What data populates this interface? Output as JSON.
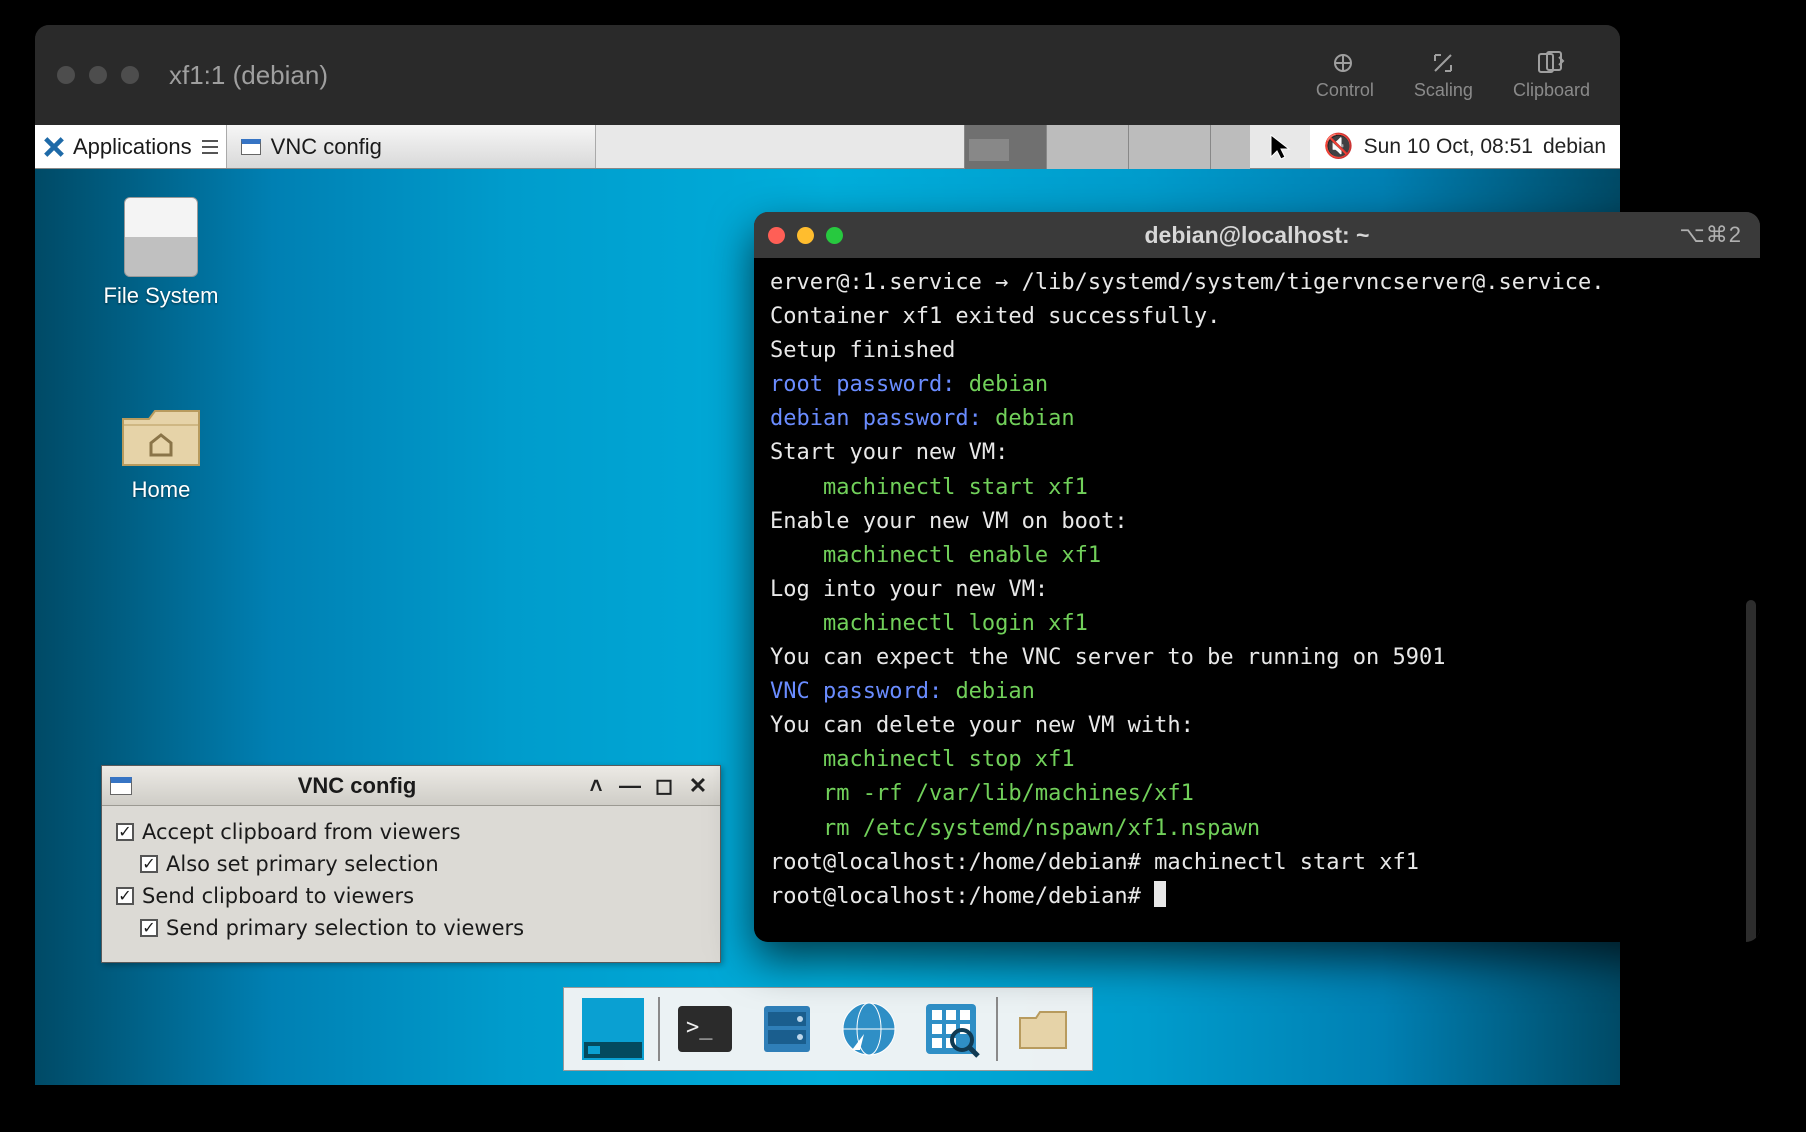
{
  "mac": {
    "title": "xf1:1 (debian)",
    "toolbar": {
      "control": "Control",
      "scaling": "Scaling",
      "clipboard": "Clipboard"
    }
  },
  "debian": {
    "applications_label": "Applications",
    "taskbar_item": "VNC config",
    "datetime": "Sun 10 Oct, 08:51",
    "user": "debian",
    "desktop": {
      "filesystem": "File System",
      "home": "Home"
    }
  },
  "vnc_config": {
    "title": "VNC config",
    "options": [
      "Accept clipboard from viewers",
      "Also set primary selection",
      "Send clipboard to viewers",
      "Send primary selection to viewers"
    ]
  },
  "dock": {
    "items": [
      "show-desktop",
      "terminal",
      "file-manager",
      "web-browser",
      "app-finder",
      "folder"
    ]
  },
  "terminal": {
    "title": "debian@localhost: ~",
    "shortcut": "⌥⌘2",
    "lines": {
      "l1": "erver@:1.service → /lib/systemd/system/tigervncserver@.service.",
      "l2": "Container xf1 exited successfully.",
      "l3": "Setup finished",
      "root_pw_label": "root password: ",
      "root_pw_val": "debian",
      "debian_pw_label": "debian password: ",
      "debian_pw_val": "debian",
      "start_hdr": "Start your new VM:",
      "start_cmd": "    machinectl start xf1",
      "enable_hdr": "Enable your new VM on boot:",
      "enable_cmd": "    machinectl enable xf1",
      "login_hdr": "Log into your new VM:",
      "login_cmd": "    machinectl login xf1",
      "vnc_expect": "You can expect the VNC server to be running on 5901",
      "vnc_pw_label": "VNC password: ",
      "vnc_pw_val": "debian",
      "delete_hdr": "You can delete your new VM with:",
      "delete_cmd1": "    machinectl stop xf1",
      "delete_cmd2": "    rm -rf /var/lib/machines/xf1",
      "delete_cmd3": "    rm /etc/systemd/nspawn/xf1.nspawn",
      "prompt1": "root@localhost:/home/debian# machinectl start xf1",
      "prompt2": "root@localhost:/home/debian# "
    }
  }
}
